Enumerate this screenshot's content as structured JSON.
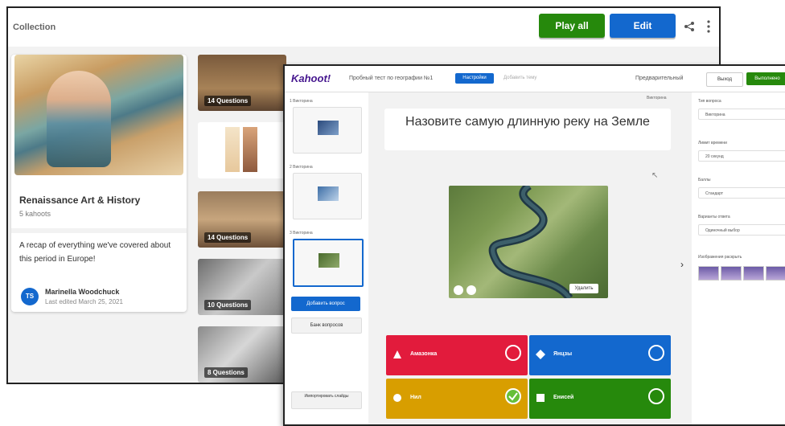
{
  "collection": {
    "title": "Collection",
    "play_all": "Play all",
    "edit": "Edit",
    "card": {
      "title": "Renaissance Art & History",
      "subtitle": "5 kahoots",
      "description": "A recap of everything we've covered about this period in Europe!",
      "author_initials": "TS",
      "author": "Marinella Woodchuck",
      "edited": "Last edited March 25, 2021"
    },
    "thumbnails": [
      {
        "label": "14 Questions"
      },
      {
        "label": ""
      },
      {
        "label": "14 Questions"
      },
      {
        "label": "10 Questions"
      },
      {
        "label": "8 Questions"
      }
    ]
  },
  "editor": {
    "logo": "Kahoot!",
    "title": "Пробный тест по географии №1",
    "settings": "Настройки",
    "theme": "Добавить тему",
    "preview": "Предварительный",
    "exit": "Выход",
    "done": "Выполнено",
    "slides": [
      {
        "label": "1 Викторина"
      },
      {
        "label": "2 Викторина"
      },
      {
        "label": "3 Викторина"
      }
    ],
    "add_question": "Добавить вопрос",
    "question_bank": "Банк вопросов",
    "import_slides": "Импортировать слайды",
    "question_counter": "Викторина",
    "question": "Назовите самую длинную реку на Земле",
    "image_delete": "Удалить",
    "answers": [
      {
        "text": "Амазонка",
        "color": "#e21b3c",
        "shape": "triangle",
        "correct": false
      },
      {
        "text": "Янцзы",
        "color": "#1368ce",
        "shape": "diamond",
        "correct": false
      },
      {
        "text": "Нил",
        "color": "#d89e00",
        "shape": "circle",
        "correct": true
      },
      {
        "text": "Енисей",
        "color": "#26890c",
        "shape": "square",
        "correct": false
      }
    ],
    "right_panel": {
      "type_label": "Тип вопроса",
      "type_value": "Викторина",
      "time_label": "Лимит времени",
      "time_value": "20 секунд",
      "points_label": "Баллы",
      "points_value": "Стандарт",
      "answers_label": "Варианты ответа",
      "answers_value": "Одиночный выбор",
      "media_label": "Изображения раскрыть"
    }
  }
}
